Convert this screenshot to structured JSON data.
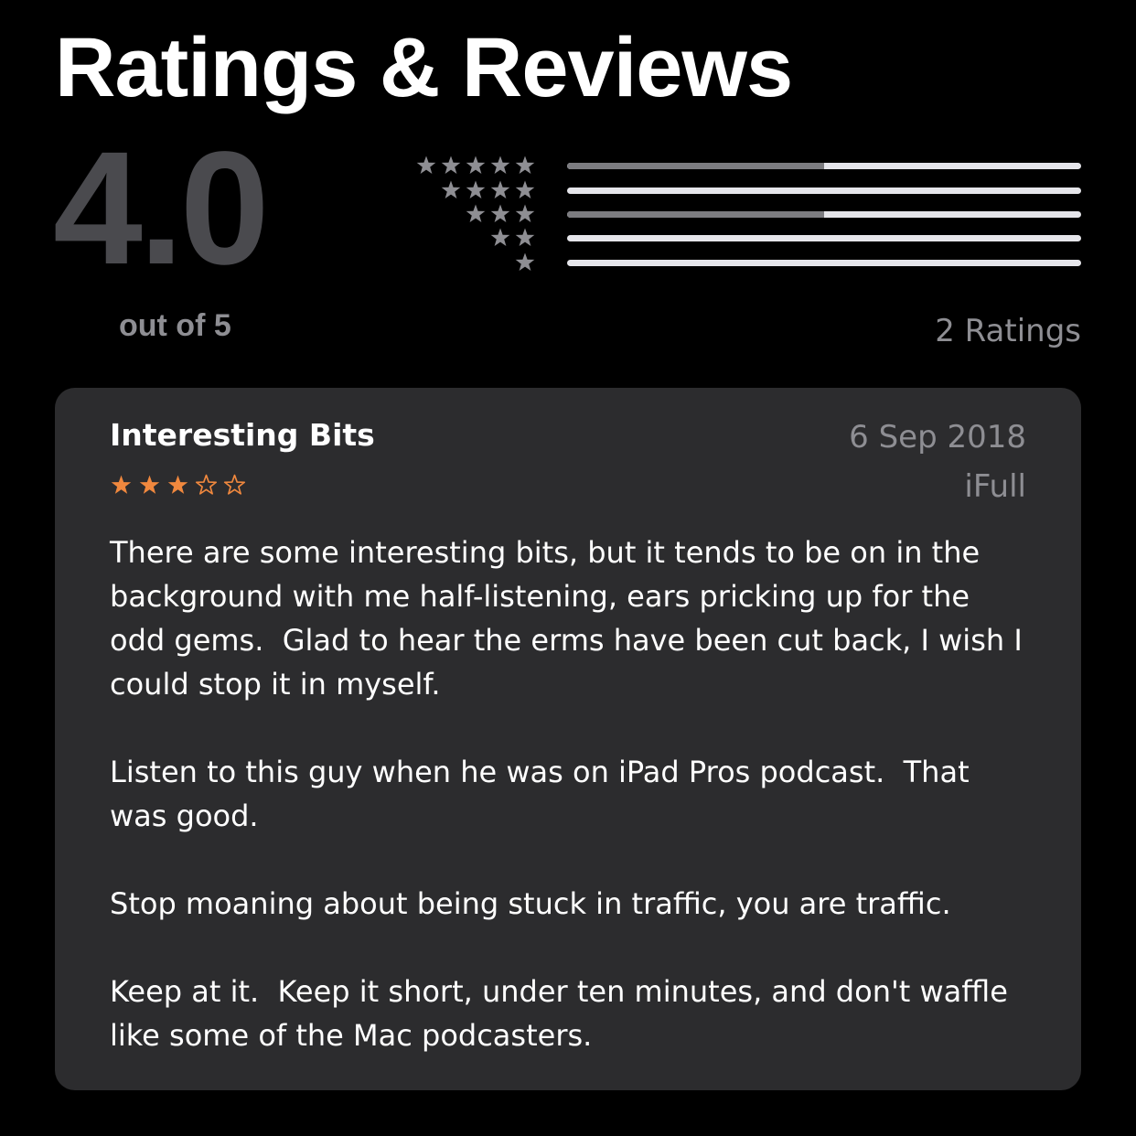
{
  "header": {
    "title": "Ratings & Reviews"
  },
  "summary": {
    "average": "4.0",
    "out_of": "out of 5",
    "ratings_count": "2 Ratings",
    "histogram": [
      {
        "stars": 5,
        "fraction": 0.5
      },
      {
        "stars": 4,
        "fraction": 0
      },
      {
        "stars": 3,
        "fraction": 0.5
      },
      {
        "stars": 2,
        "fraction": 0
      },
      {
        "stars": 1,
        "fraction": 0
      }
    ]
  },
  "review": {
    "title": "Interesting Bits",
    "date": "6 Sep 2018",
    "author": "iFull",
    "rating": 3,
    "max_rating": 5,
    "paragraphs": [
      "There are some interesting bits, but it tends to be on in the background with me half-listening, ears pricking up for the odd gems.  Glad to hear the erms have been cut back, I wish I could stop it in myself.",
      "Listen to this guy when he was on iPad Pros podcast.  That was good.",
      "Stop moaning about being stuck in traffic, you are traffic.",
      "Keep at it.  Keep it short, under ten minutes, and don't waffle like some of the Mac podcasters."
    ]
  },
  "colors": {
    "background": "#000000",
    "card": "#2c2c2e",
    "secondary_text": "#8e8e93",
    "average_score": "#4a4a4e",
    "histogram_star": "#8e8e93",
    "histogram_track": "#e5e5ea",
    "histogram_fill": "#7c7c80",
    "review_star": "#f0883e"
  },
  "icons": {
    "histogram_star": "star-filled-icon",
    "review_star_filled": "star-filled-icon",
    "review_star_empty": "star-outline-icon"
  }
}
